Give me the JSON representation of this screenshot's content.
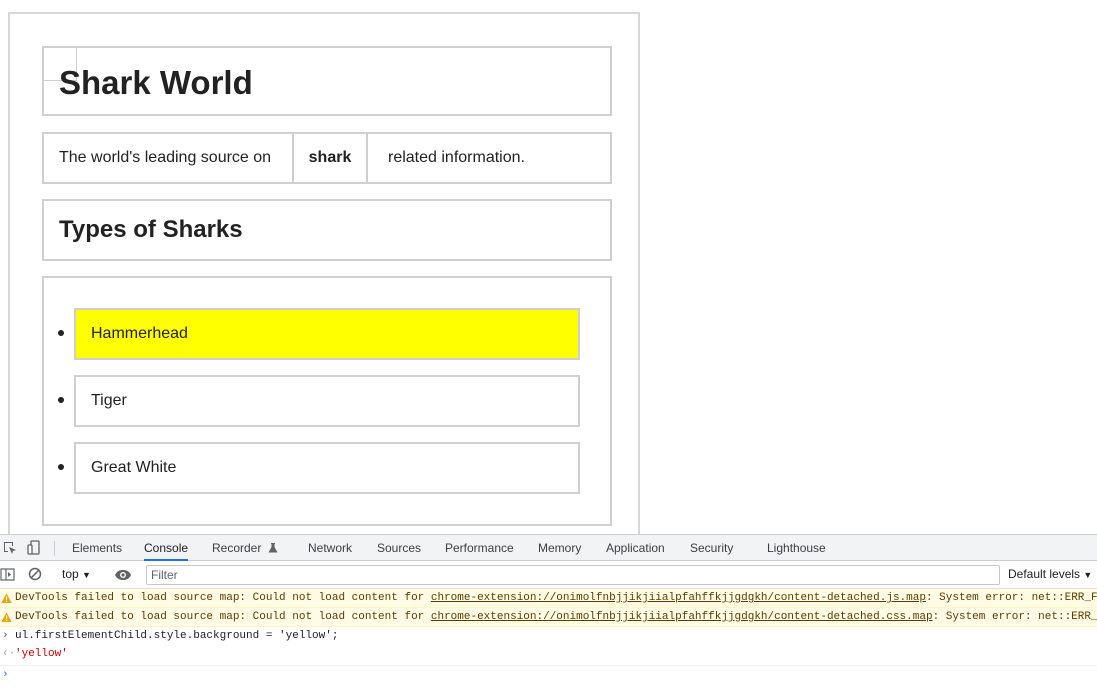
{
  "page": {
    "title": "Shark World",
    "tagline_part1": "The world's leading source on",
    "tagline_bold": "shark",
    "tagline_part2": "related information.",
    "subtitle": "Types of Sharks",
    "shark_types": [
      {
        "label": "Hammerhead",
        "highlight": "#ffff00"
      },
      {
        "label": "Tiger",
        "highlight": ""
      },
      {
        "label": "Great White",
        "highlight": ""
      }
    ]
  },
  "devtools": {
    "tabs": [
      {
        "label": "Elements",
        "active": false
      },
      {
        "label": "Console",
        "active": true
      },
      {
        "label": "Recorder",
        "active": false
      },
      {
        "label": "Network",
        "active": false
      },
      {
        "label": "Sources",
        "active": false
      },
      {
        "label": "Performance",
        "active": false
      },
      {
        "label": "Memory",
        "active": false
      },
      {
        "label": "Application",
        "active": false
      },
      {
        "label": "Security",
        "active": false
      },
      {
        "label": "Lighthouse",
        "active": false
      }
    ],
    "toolbar": {
      "context": "top",
      "filter_placeholder": "Filter",
      "levels": "Default levels"
    },
    "console": {
      "warning1_prefix": "DevTools failed to load source map: Could not load content for ",
      "warning1_link": "chrome-extension://onimolfnbjjikjiialpfahffkjjgdgkh/content-detached.js.map",
      "warning1_suffix": ": System error: net::ERR_F",
      "warning2_prefix": "DevTools failed to load source map: Could not load content for ",
      "warning2_link": "chrome-extension://onimolfnbjjikjiialpfahffkjjgdgkh/content-detached.css.map",
      "warning2_suffix": ": System error: net::ERR_F",
      "input": "ul.firstElementChild.style.background = 'yellow';",
      "result": "'yellow'"
    },
    "colors": {
      "accent": "#1a73e8",
      "warning_bg": "#fffbe5",
      "warning_text": "#5c3c00",
      "string_result": "#c80000"
    }
  }
}
